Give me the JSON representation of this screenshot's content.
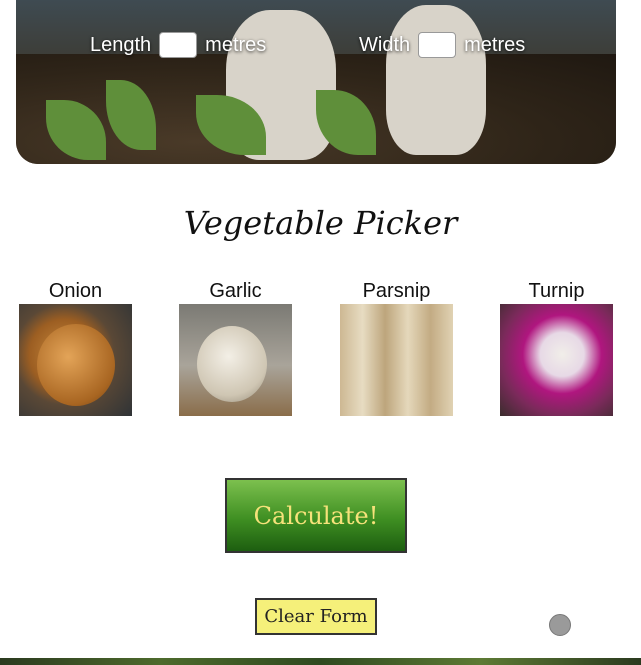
{
  "hero": {
    "length_label": "Length",
    "width_label": "Width",
    "unit_label": "metres",
    "length_value": "",
    "width_value": ""
  },
  "title": "Vegetable Picker",
  "vegetables": [
    {
      "label": "Onion"
    },
    {
      "label": "Garlic"
    },
    {
      "label": "Parsnip"
    },
    {
      "label": "Turnip"
    }
  ],
  "buttons": {
    "calculate_label": "Calculate!",
    "clear_label": "Clear Form"
  }
}
